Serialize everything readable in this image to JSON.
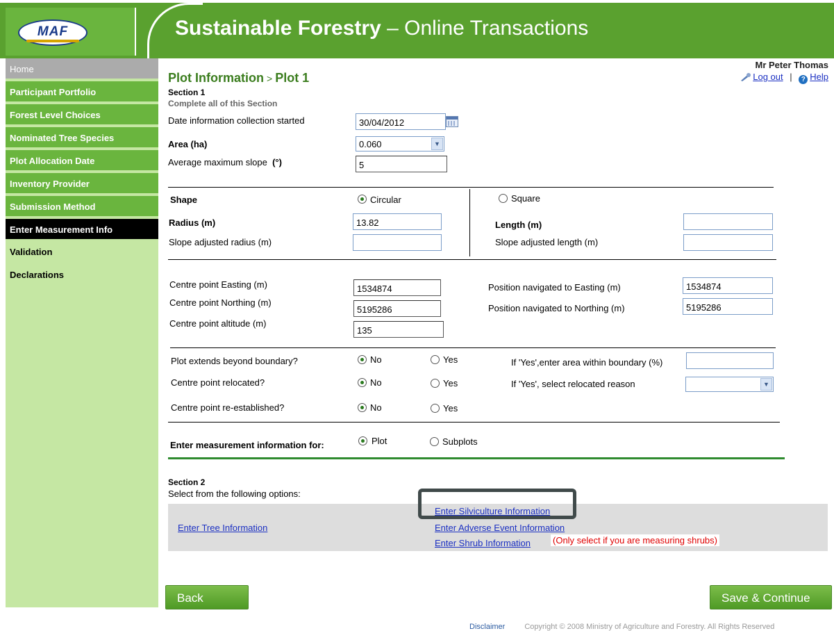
{
  "header": {
    "logo_text": "MAF",
    "title_bold": "Sustainable Forestry",
    "title_rest": " – Online Transactions"
  },
  "sidebar": {
    "items": [
      {
        "label": "Home"
      },
      {
        "label": "Participant Portfolio"
      },
      {
        "label": "Forest Level Choices"
      },
      {
        "label": "Nominated Tree Species"
      },
      {
        "label": "Plot Allocation Date"
      },
      {
        "label": "Inventory Provider"
      },
      {
        "label": "Submission Method"
      },
      {
        "label": "Enter Measurement Info"
      },
      {
        "label": "Validation"
      },
      {
        "label": "Declarations"
      }
    ]
  },
  "user": {
    "name": "Mr Peter Thomas",
    "logout": "Log out",
    "separator": "|",
    "help": "Help"
  },
  "page": {
    "title": "Plot Information",
    "breadcrumb_sep": ">",
    "subtitle": "Plot 1",
    "section1": "Section 1",
    "section1_sub": "Complete all of this Section"
  },
  "section1": {
    "date_label": "Date information collection started",
    "date_value": "30/04/2012",
    "area_label": "Area (ha)",
    "area_value": "0.060",
    "slope_label": "Average maximum slope",
    "slope_unit": "(°)",
    "slope_value": "5"
  },
  "shape": {
    "label": "Shape",
    "circular": "Circular",
    "square": "Square",
    "radius_label": "Radius (m)",
    "radius_value": "13.82",
    "slope_radius_label": "Slope adjusted radius (m)",
    "slope_radius_value": "",
    "length_label": "Length (m)",
    "length_value": "",
    "slope_length_label": "Slope adjusted length (m)",
    "slope_length_value": ""
  },
  "position": {
    "easting_label": "Centre point Easting (m)",
    "easting_value": "1534874",
    "northing_label": "Centre point Northing (m)",
    "northing_value": "5195286",
    "altitude_label": "Centre point altitude (m)",
    "altitude_value": "135",
    "nav_easting_label": "Position navigated to Easting (m)",
    "nav_easting_value": "1534874",
    "nav_northing_label": "Position navigated to Northing (m)",
    "nav_northing_value": "5195286"
  },
  "questions": {
    "boundary_label": "Plot extends beyond boundary?",
    "relocated_label": "Centre point relocated?",
    "reestablished_label": "Centre point re-established?",
    "no": "No",
    "yes": "Yes",
    "boundary_area_label": "If 'Yes',enter area within boundary (%)",
    "boundary_area_value": "",
    "reason_label": "If 'Yes', select relocated reason",
    "reason_value": ""
  },
  "measurement": {
    "label": "Enter measurement information for:",
    "plot": "Plot",
    "subplots": "Subplots"
  },
  "section2": {
    "title": "Section 2",
    "subtitle": "Select from the following options:",
    "tree_link": "Enter Tree Information",
    "silviculture_link": "Enter Silviculture Information",
    "adverse_link": "Enter Adverse Event Information",
    "shrub_link": "Enter Shrub Information",
    "shrub_note": "(Only select if you are measuring shrubs)"
  },
  "buttons": {
    "back": "Back",
    "save": "Save & Continue"
  },
  "footer": {
    "disclaimer": "Disclaimer",
    "copyright": "Copyright © 2008 Ministry of Agriculture and Forestry. All Rights Reserved"
  }
}
